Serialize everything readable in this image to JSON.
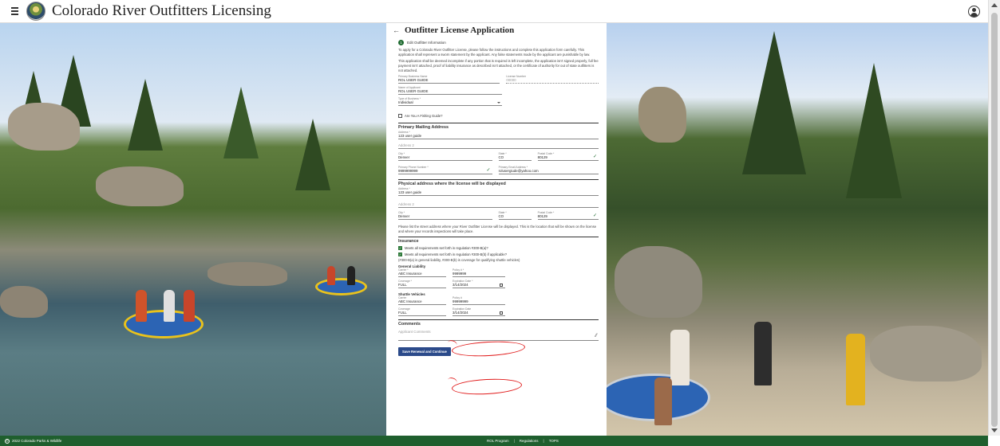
{
  "header": {
    "title": "Colorado River Outfitters Licensing",
    "menu_icon": "hamburger-menu-icon",
    "logo_icon": "state-seal-logo",
    "account_icon": "account-circle-icon"
  },
  "form": {
    "title": "Outfitter License Application",
    "step_number": "1",
    "step_label": "Edit Outfitter Information",
    "intro_1": "To apply for a Colorado River Outfitter License, please follow the instructions and complete this application form carefully. This application shall represent a sworn statement by the applicant. Any false statements made by the applicant are punishable by law.",
    "intro_2": "This application shall be deemed incomplete if any portion that is required is left incomplete, the application isn't signed properly, full fee payment isn't attached, proof of liability insurance as described isn't attached, or the certificate of authority for out of state outfitters is not attached.",
    "business_name": {
      "label": "Primary Business Name",
      "value": "ROL USER GUIDE"
    },
    "license_number": {
      "label": "License Number",
      "value": "00000"
    },
    "applicant_name": {
      "label": "Name of Applicant",
      "value": "ROL USER GUIDE"
    },
    "business_type": {
      "label": "Type of Business *",
      "value": "Individual"
    },
    "fishing_guide_label": "Are You A Fishing Guide?",
    "mailing": {
      "heading": "Primary Mailing Address",
      "address_label": "Address *",
      "address": "123 user guide",
      "address2_placeholder": "Address 2",
      "city_label": "City *",
      "city": "Denver",
      "state_label": "State *",
      "state": "CO",
      "zip_label": "Postal Code *",
      "zip": "80129",
      "phone_label": "Primary Phone Number *",
      "phone": "9999999999",
      "email_label": "Primary Email Address *",
      "email": "rolusergiude@yahoo.com"
    },
    "physical": {
      "heading": "Physical address where the license will be displayed",
      "address_label": "Address *",
      "address": "123 user guide",
      "address2_placeholder": "Address 2",
      "city_label": "City *",
      "city": "Denver",
      "state_label": "State *",
      "state": "CO",
      "zip_label": "Postal Code *",
      "zip": "80129"
    },
    "display_note": "Please list the street address where your River Outfitter License will be displayed. This is the location that will be shown on the license and where your records inspections will take place.",
    "insurance": {
      "heading": "Insurance",
      "check1": "Meets all requirements set forth in regulation #300-B(a)?",
      "check2": "Meets all requirements set forth in regulation #300-B(b) if applicable?",
      "note": "(#300-B(a) is general liability, #300-B(b) is coverage for qualifying shuttle vehicles)",
      "general": {
        "heading": "General Liability",
        "carrier_label": "Carrier *",
        "carrier": "ABC Insurance",
        "policy_label": "Policy # *",
        "policy": "9999999",
        "coverage_label": "Coverage *",
        "coverage": "FULL",
        "exp_label": "Expiration Date *",
        "exp": "3/14/2024"
      },
      "shuttle": {
        "heading": "Shuttle Vehicles",
        "carrier_label": "Carrier",
        "carrier": "ABC Insurance",
        "policy_label": "Policy #",
        "policy": "99999999",
        "coverage_label": "Coverage",
        "coverage": "FULL",
        "exp_label": "Expiration Date",
        "exp": "3/14/2024"
      }
    },
    "comments": {
      "heading": "Comments",
      "placeholder": "Applicant Comments"
    },
    "submit_label": "Save Renewal and Continue"
  },
  "footer": {
    "copyright": "2022 Colorado Parks & Wildlife",
    "links": [
      "ROL Program",
      "Regulations",
      "TOPS"
    ]
  },
  "colors": {
    "footer_green": "#1f5f2e",
    "button_blue": "#2b4a8a",
    "annotation_red": "#e01818",
    "check_green": "#2f7a3b"
  }
}
